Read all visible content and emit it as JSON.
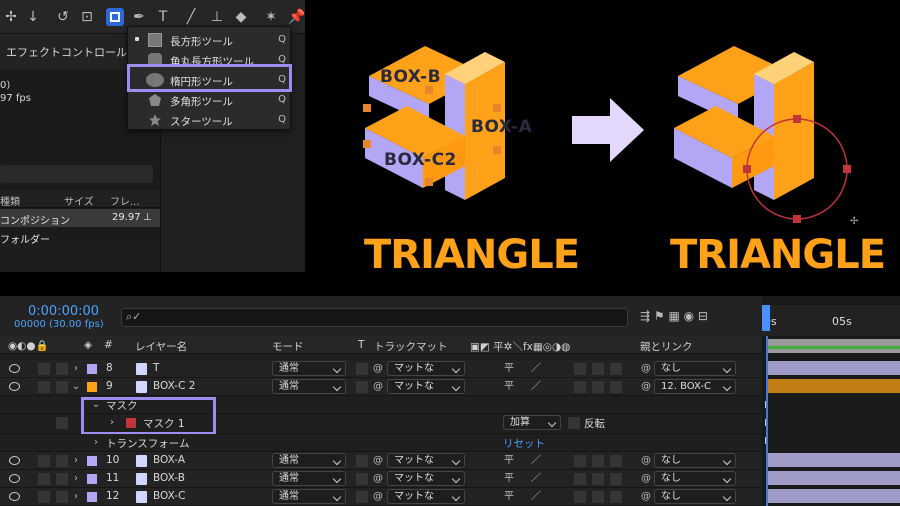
{
  "toolbar": {
    "tool_icons": [
      "move-icon",
      "zoom-icon",
      "rotate-icon",
      "camera-icon",
      "rectangle-tool-icon",
      "pen-icon",
      "text-icon",
      "brush-icon",
      "stamp-icon",
      "eraser-icon",
      "puppet-icon",
      "pin-icon"
    ],
    "text_tool": "T"
  },
  "project_panel": {
    "tab_label": "エフェクトコントロール",
    "info_line1": "0)",
    "info_line2": "97 fps",
    "headers": {
      "type": "種類",
      "size": "サイズ",
      "frame": "フレ..."
    },
    "rows": [
      {
        "name": "コンポジション",
        "fps": "29.97"
      },
      {
        "name": "フォルダー"
      }
    ]
  },
  "shape_menu": {
    "items": [
      {
        "label": "長方形ツール",
        "key": "Q",
        "icon": "rectangle-icon"
      },
      {
        "label": "角丸長方形ツール",
        "key": "Q",
        "icon": "rounded-rect-icon"
      },
      {
        "label": "楕円形ツール",
        "key": "Q",
        "icon": "ellipse-icon"
      },
      {
        "label": "多角形ツール",
        "key": "Q",
        "icon": "polygon-icon"
      },
      {
        "label": "スターツール",
        "key": "Q",
        "icon": "star-icon"
      }
    ]
  },
  "artwork": {
    "label_box_b": "BOX-B",
    "label_box_a": "BOX-A",
    "label_box_c2": "BOX-C2",
    "title_left": "TRIANGLE",
    "title_right": "TRIANGLE",
    "colors": {
      "orange": "#ffa219",
      "lavender": "#b2a6f5",
      "accent_purple": "#9a8ff0",
      "mask_red": "#c0343a"
    }
  },
  "timeline": {
    "timecode": "0:00:00:00",
    "fps": "00000 (30.00 fps)",
    "search_placeholder": "⌕✓",
    "ruler": {
      "t0": "0s",
      "t1": "05s"
    },
    "headers": {
      "num": "#",
      "layer_name": "レイヤー名",
      "mode": "モード",
      "t": "T",
      "track_matte": "トラックマット",
      "parent": "親とリンク"
    },
    "rows": [
      {
        "num": "8",
        "name": "T",
        "mode": "通常",
        "matte": "マットな",
        "parent": "なし",
        "color": "#b2a6f5"
      },
      {
        "num": "9",
        "name": "BOX-C 2",
        "mode": "通常",
        "matte": "マットな",
        "parent": "12. BOX-C",
        "color": "#ffa219"
      }
    ],
    "mask_group": {
      "label": "マスク",
      "mask_name": "マスク 1",
      "mask_mode": "加算",
      "invert_label": "反転"
    },
    "transform": {
      "label": "トランスフォーム",
      "reset": "リセット"
    },
    "rows_after": [
      {
        "num": "10",
        "name": "BOX-A",
        "mode": "通常",
        "matte": "マットな",
        "parent": "なし",
        "color": "#b2a6f5"
      },
      {
        "num": "11",
        "name": "BOX-B",
        "mode": "通常",
        "matte": "マットな",
        "parent": "なし",
        "color": "#b2a6f5"
      },
      {
        "num": "12",
        "name": "BOX-C",
        "mode": "通常",
        "matte": "マットな",
        "parent": "なし",
        "color": "#b2a6f5"
      }
    ]
  }
}
